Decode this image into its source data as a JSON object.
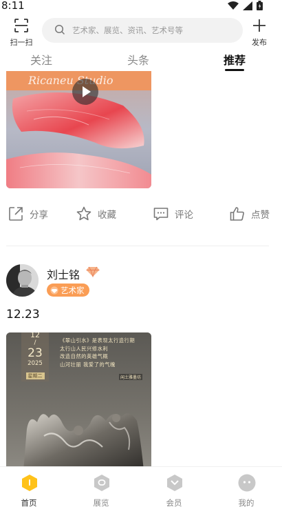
{
  "status_bar": {
    "time": "8:11"
  },
  "header": {
    "scan_label": "扫一扫",
    "search_placeholder": "艺术家、展览、资讯、艺术号等",
    "publish_label": "发布"
  },
  "tabs": [
    {
      "label": "关注",
      "active": false
    },
    {
      "label": "头条",
      "active": false
    },
    {
      "label": "推荐",
      "active": true
    }
  ],
  "feed": {
    "post1": {
      "image_caption": "Ricaneu Studio",
      "actions": [
        {
          "label": "分享",
          "icon": "share-icon"
        },
        {
          "label": "收藏",
          "icon": "star-icon"
        },
        {
          "label": "评论",
          "icon": "comment-icon"
        },
        {
          "label": "点赞",
          "icon": "thumbs-up-icon"
        }
      ]
    },
    "post2": {
      "author_name": "刘士铭",
      "author_badge": "艺术家",
      "text": "12.23",
      "poster": {
        "month": "12",
        "separator": "/",
        "day": "23",
        "year": "2025",
        "weekday": "星期二",
        "poem_lines": [
          "《翠山引水》是表现太行造行期",
          "太行山人民兴修水利",
          "改造自然的英雄气概",
          "山河壮丽 我爱了的气魄"
        ],
        "stamp": "闲土雅墨坊"
      }
    }
  },
  "bottom_nav": [
    {
      "label": "首页",
      "icon": "home-icon",
      "active": true
    },
    {
      "label": "展览",
      "icon": "exhibition-icon",
      "active": false
    },
    {
      "label": "会员",
      "icon": "member-icon",
      "active": false
    },
    {
      "label": "我的",
      "icon": "profile-icon",
      "active": false
    }
  ],
  "colors": {
    "accent_orange": "#fa9d55",
    "home_icon_yellow": "#ffc21a",
    "nav_icon_gray": "#c8c8c8"
  }
}
